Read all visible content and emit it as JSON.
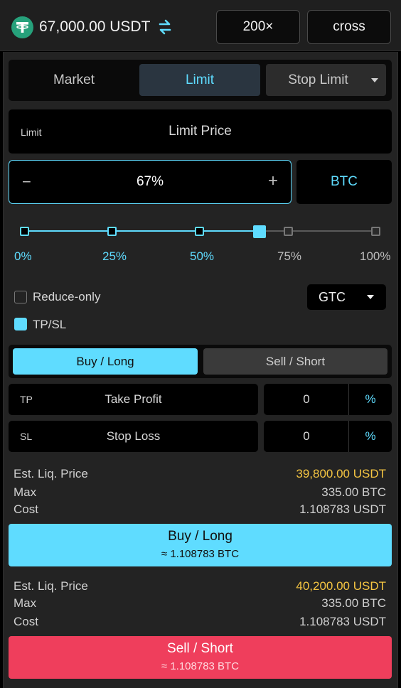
{
  "header": {
    "balance": "67,000.00 USDT",
    "leverage": "200×",
    "margin_mode": "cross",
    "token_icon": "tether-icon",
    "swap_icon": "swap-icon"
  },
  "order_tabs": {
    "market": "Market",
    "limit": "Limit",
    "stop_limit": "Stop Limit",
    "active": "Limit"
  },
  "limit_price": {
    "tag": "Limit",
    "placeholder": "Limit Price"
  },
  "amount": {
    "value": "67%",
    "minus": "−",
    "plus": "+",
    "unit": "BTC"
  },
  "slider": {
    "value_percent": 67,
    "stops": [
      "0%",
      "25%",
      "50%",
      "75%",
      "100%"
    ]
  },
  "options": {
    "reduce_only": "Reduce-only",
    "reduce_only_checked": false,
    "tpsl": "TP/SL",
    "tpsl_checked": true,
    "time_in_force": "GTC"
  },
  "side_tabs": {
    "buy": "Buy / Long",
    "sell": "Sell / Short",
    "active": "Buy / Long"
  },
  "tp": {
    "tag": "TP",
    "placeholder": "Take Profit",
    "value": "0",
    "unit": "%"
  },
  "sl": {
    "tag": "SL",
    "placeholder": "Stop Loss",
    "value": "0",
    "unit": "%"
  },
  "buy_info": {
    "liq_label": "Est. Liq. Price",
    "liq_value": "39,800.00 USDT",
    "max_label": "Max",
    "max_value": "335.00 BTC",
    "cost_label": "Cost",
    "cost_value": "1.108783 USDT"
  },
  "buy_button": {
    "label": "Buy / Long",
    "sub": "≈ 1.108783 BTC"
  },
  "sell_info": {
    "liq_label": "Est. Liq. Price",
    "liq_value": "40,200.00 USDT",
    "max_label": "Max",
    "max_value": "335.00 BTC",
    "cost_label": "Cost",
    "cost_value": "1.108783 USDT"
  },
  "sell_button": {
    "label": "Sell / Short",
    "sub": "≈ 1.108783 BTC"
  },
  "colors": {
    "accent": "#5fdcff",
    "sell": "#ef3e5c",
    "warning": "#f5c542",
    "tether": "#26a17b"
  }
}
